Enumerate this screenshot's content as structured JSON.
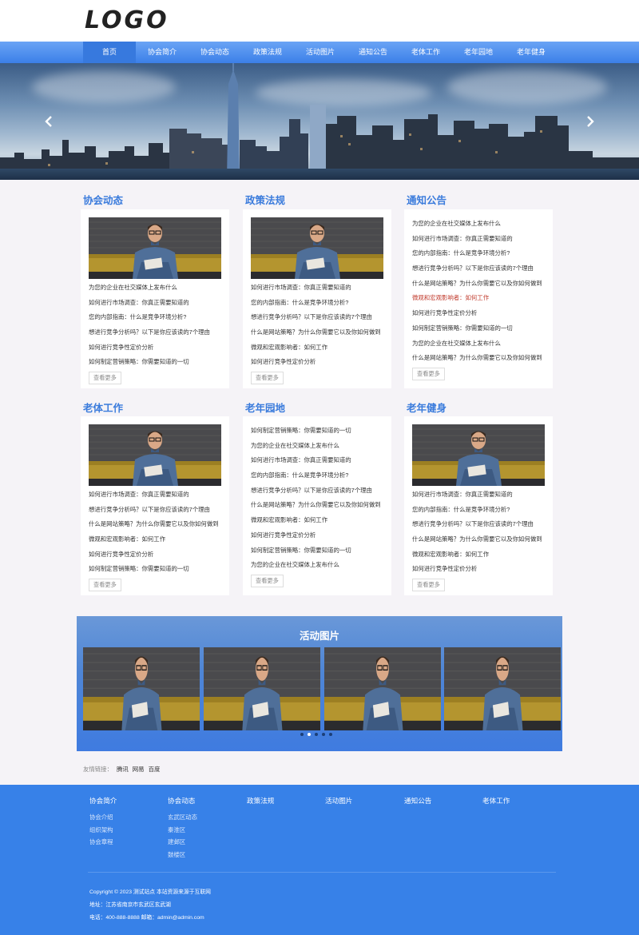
{
  "header": {
    "logo": "LOGO"
  },
  "nav": {
    "items": [
      {
        "label": "首页",
        "active": true
      },
      {
        "label": "协会简介"
      },
      {
        "label": "协会动态"
      },
      {
        "label": "政策法规"
      },
      {
        "label": "活动图片"
      },
      {
        "label": "通知公告"
      },
      {
        "label": "老体工作"
      },
      {
        "label": "老年园地"
      },
      {
        "label": "老年健身"
      }
    ]
  },
  "banner": {
    "prev_icon": "chevron-left-icon",
    "next_icon": "chevron-right-icon"
  },
  "sections": [
    {
      "title": "协会动态",
      "has_image": true,
      "items": [
        "为您的企业在社交媒体上发布什么",
        "如何进行市场调查：你真正需要知道的",
        "您的内部指南：什么是竞争环境分析?",
        "想进行竞争分析吗？以下是你应该读的7个理由",
        "如何进行竞争性定价分析",
        "如何制定营销策略：你需要知道的一切"
      ],
      "more": "查看更多"
    },
    {
      "title": "政策法规",
      "has_image": true,
      "items": [
        "如何进行市场调查：你真正需要知道的",
        "您的内部指南：什么是竞争环境分析?",
        "想进行竞争分析吗？以下是你应该读的7个理由",
        "什么是网站策略？为什么你需要它以及你如何做到",
        "微观和宏观影响者：如何工作",
        "如何进行竞争性定价分析"
      ],
      "more": "查看更多"
    },
    {
      "title": "通知公告",
      "has_image": false,
      "items": [
        "为您的企业在社交媒体上发布什么",
        "如何进行市场调查：你真正需要知道的",
        "您的内部指南：什么是竞争环境分析?",
        "想进行竞争分析吗？以下是你应该读的7个理由",
        "什么是网站策略？为什么你需要它以及你如何做到",
        "微观和宏观影响者：如何工作",
        "如何进行竞争性定价分析",
        "如何制定营销策略：你需要知道的一切",
        "为您的企业在社交媒体上发布什么",
        "什么是网站策略？为什么你需要它以及你如何做到"
      ],
      "highlight_index": 5,
      "highlight_color": "#c0392b",
      "more": "查看更多"
    },
    {
      "title": "老体工作",
      "has_image": true,
      "items": [
        "如何进行市场调查：你真正需要知道的",
        "想进行竞争分析吗？以下是你应该读的7个理由",
        "什么是网站策略？为什么你需要它以及你如何做到",
        "微观和宏观影响者：如何工作",
        "如何进行竞争性定价分析",
        "如何制定营销策略：你需要知道的一切"
      ],
      "more": "查看更多"
    },
    {
      "title": "老年园地",
      "has_image": false,
      "items": [
        "如何制定营销策略：你需要知道的一切",
        "为您的企业在社交媒体上发布什么",
        "如何进行市场调查：你真正需要知道的",
        "您的内部指南：什么是竞争环境分析?",
        "想进行竞争分析吗？以下是你应该读的7个理由",
        "什么是网站策略？为什么你需要它以及你如何做到",
        "微观和宏观影响者：如何工作",
        "如何进行竞争性定价分析",
        "如何制定营销策略：你需要知道的一切",
        "为您的企业在社交媒体上发布什么"
      ],
      "more": "查看更多"
    },
    {
      "title": "老年健身",
      "has_image": true,
      "items": [
        "如何进行市场调查：你真正需要知道的",
        "您的内部指南：什么是竞争环境分析?",
        "想进行竞争分析吗？以下是你应该读的7个理由",
        "什么是网站策略？为什么你需要它以及你如何做到",
        "微观和宏观影响者：如何工作",
        "如何进行竞争性定价分析"
      ],
      "more": "查看更多"
    }
  ],
  "gallery": {
    "title": "活动图片",
    "photo_count": 4,
    "dot_count": 5,
    "active_dot": 1
  },
  "links": {
    "label": "友情链接：",
    "items": [
      "腾讯",
      "网易",
      "百度"
    ]
  },
  "footer": {
    "columns": [
      {
        "title": "协会简介",
        "items": [
          "协会介绍",
          "组织架构",
          "协会章程"
        ]
      },
      {
        "title": "协会动态",
        "items": [
          "玄武区动态",
          "秦淮区",
          "建邺区",
          "鼓楼区"
        ]
      },
      {
        "title": "政策法规",
        "items": []
      },
      {
        "title": "活动图片",
        "items": []
      },
      {
        "title": "通知公告",
        "items": []
      },
      {
        "title": "老体工作",
        "items": []
      }
    ],
    "copyright": "Copyright © 2023 测试站点 本站资源来源于互联网",
    "address": "地址：江苏省南京市玄武区玄武湖",
    "contact": "电话：400-888-8888 邮箱：admin@admin.com"
  },
  "colors": {
    "accent": "#3a7bdc",
    "nav": "#3b7fe8",
    "footer": "#3781e8",
    "highlight": "#c0392b"
  }
}
